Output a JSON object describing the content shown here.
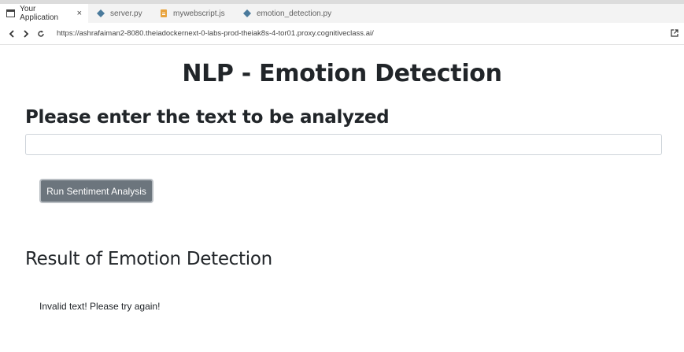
{
  "browser": {
    "tabs": [
      {
        "label": "Your Application",
        "icon": "window-icon",
        "active": true,
        "close": "×"
      },
      {
        "label": "server.py",
        "icon": "python-icon",
        "active": false
      },
      {
        "label": "mywebscript.js",
        "icon": "javascript-icon",
        "active": false
      },
      {
        "label": "emotion_detection.py",
        "icon": "python-icon",
        "active": false
      }
    ],
    "url": "https://ashrafaiman2-8080.theiadockernext-0-labs-prod-theiak8s-4-tor01.proxy.cognitiveclass.ai/"
  },
  "page": {
    "title": "NLP - Emotion Detection",
    "prompt_label": "Please enter the text to be analyzed",
    "input_value": "",
    "button_label": "Run Sentiment Analysis",
    "result_heading": "Result of Emotion Detection",
    "result_text": "Invalid text! Please try again!"
  },
  "colors": {
    "button_bg": "#6c757d",
    "text": "#212529",
    "python_icon": "#4a7a9c",
    "js_icon": "#e8a33d"
  }
}
